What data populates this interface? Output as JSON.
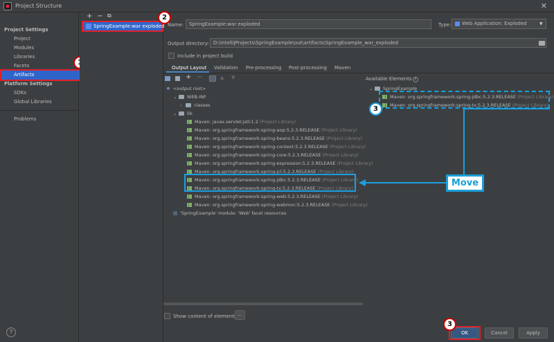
{
  "window": {
    "title": "Project Structure"
  },
  "sidebar": {
    "project_settings_label": "Project Settings",
    "project_settings_items": [
      "Project",
      "Modules",
      "Libraries",
      "Facets",
      "Artifacts"
    ],
    "platform_settings_label": "Platform Settings",
    "platform_settings_items": [
      "SDKs",
      "Global Libraries"
    ],
    "problems_label": "Problems",
    "selected": "Artifacts"
  },
  "artifact_list": {
    "toolbar": [
      "+",
      "−",
      "⧉"
    ],
    "items": [
      "SpringExample:war exploded"
    ]
  },
  "details": {
    "name_label": "Name:",
    "name_value": "SpringExample:war exploded",
    "type_label": "Type:",
    "type_value": "Web Application: Exploded",
    "output_dir_label": "Output directory:",
    "output_dir_value": "D:\\IntelliJProjects\\SpringExample\\out\\artifacts\\SpringExample_war_exploded",
    "include_build_label": "Include in project build",
    "tabs": [
      "Output Layout",
      "Validation",
      "Pre-processing",
      "Post-processing",
      "Maven"
    ],
    "active_tab": "Output Layout"
  },
  "layout_tree": {
    "rows": [
      {
        "text": "<output root>",
        "suffix": ""
      },
      {
        "text": "WEB-INF",
        "suffix": ""
      },
      {
        "text": "classes",
        "suffix": ""
      },
      {
        "text": "lib",
        "suffix": ""
      },
      {
        "text": "Maven: javax.servlet:jstl:1.2",
        "suffix": "(Project Library)"
      },
      {
        "text": "Maven: org.springframework:spring-aop:5.2.3.RELEASE",
        "suffix": "(Project Library)"
      },
      {
        "text": "Maven: org.springframework:spring-beans:5.2.3.RELEASE",
        "suffix": "(Project Library)"
      },
      {
        "text": "Maven: org.springframework:spring-context:5.2.3.RELEASE",
        "suffix": "(Project Library)"
      },
      {
        "text": "Maven: org.springframework:spring-core:5.2.3.RELEASE",
        "suffix": "(Project Library)"
      },
      {
        "text": "Maven: org.springframework:spring-expression:5.2.3.RELEASE",
        "suffix": "(Project Library)"
      },
      {
        "text": "Maven: org.springframework:spring-jcl:5.2.3.RELEASE",
        "suffix": "(Project Library)"
      },
      {
        "text": "Maven: org.springframework:spring-jdbc:5.2.3.RELEASE",
        "suffix": "(Project Library)"
      },
      {
        "text": "Maven: org.springframework:spring-tx:5.2.3.RELEASE",
        "suffix": "(Project Library)"
      },
      {
        "text": "Maven: org.springframework:spring-web:5.2.3.RELEASE",
        "suffix": "(Project Library)"
      },
      {
        "text": "Maven: org.springframework:spring-webmvc:5.2.3.RELEASE",
        "suffix": "(Project Library)"
      },
      {
        "text": "'SpringExample' module: 'Web' facet resources",
        "suffix": ""
      }
    ],
    "show_content_label": "Show content of elements",
    "ellipsis": "..."
  },
  "available": {
    "label": "Available Elements",
    "help": "?",
    "root": "SpringExample",
    "items": [
      {
        "text": "Maven: org.springframework:spring-jdbc:5.2.3.RELEASE",
        "suffix": "(Project Library)"
      },
      {
        "text": "Maven: org.springframework:spring-tx:5.2.3.RELEASE",
        "suffix": "(Project Library)"
      }
    ]
  },
  "annotations": {
    "badge1": "1",
    "badge2": "2",
    "badge3": "3",
    "badge3b": "3",
    "move": "Move"
  },
  "buttons": {
    "ok": "OK",
    "cancel": "Cancel",
    "apply": "Apply",
    "help": "?"
  },
  "colors": {
    "selection": "#2f65ca",
    "annotation_red": "#e0202a",
    "annotation_blue": "#1aa0e0",
    "background": "#3c3f41"
  }
}
